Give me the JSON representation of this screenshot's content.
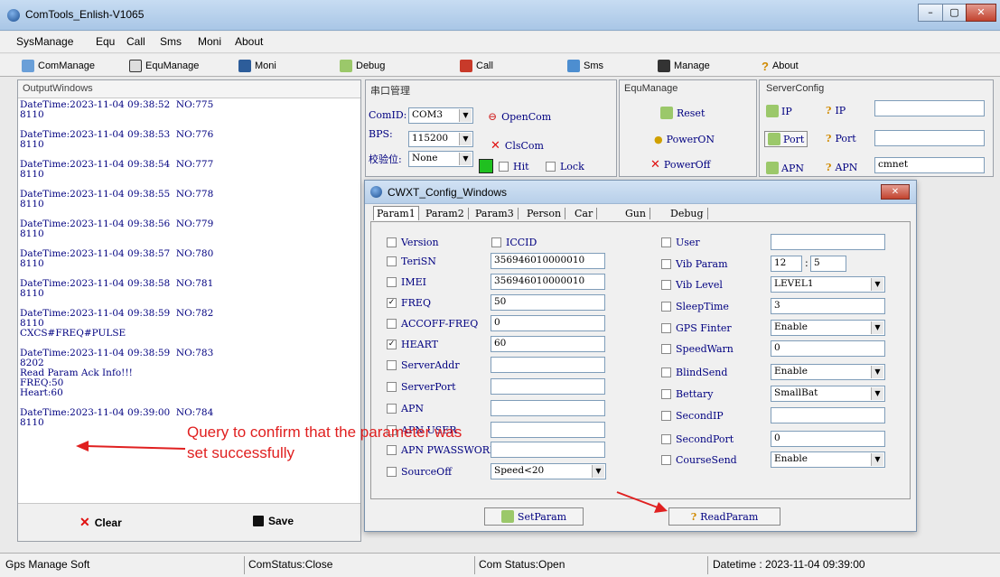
{
  "window": {
    "title": "ComTools_Enlish-V1065",
    "min": "–",
    "max": "▢",
    "close": "✕"
  },
  "menu": [
    "SysManage",
    "Equ",
    "Call",
    "Sms",
    "Moni",
    "About"
  ],
  "toolbar": [
    "ComManage",
    "EquManage",
    "Moni",
    "Debug",
    "Call",
    "Sms",
    "Manage",
    "About"
  ],
  "output": {
    "title": "OutputWindows",
    "log": "DateTime:2023-11-04 09:38:52  NO:775\n8110\n\nDateTime:2023-11-04 09:38:53  NO:776\n8110\n\nDateTime:2023-11-04 09:38:54  NO:777\n8110\n\nDateTime:2023-11-04 09:38:55  NO:778\n8110\n\nDateTime:2023-11-04 09:38:56  NO:779\n8110\n\nDateTime:2023-11-04 09:38:57  NO:780\n8110\n\nDateTime:2023-11-04 09:38:58  NO:781\n8110\n\nDateTime:2023-11-04 09:38:59  NO:782\n8110\nCXCS#FREQ#PULSE\n\nDateTime:2023-11-04 09:38:59  NO:783\n8202\nRead Param Ack Info!!!\nFREQ:50\nHeart:60\n\nDateTime:2023-11-04 09:39:00  NO:784\n8110",
    "clear": "Clear",
    "save": "Save"
  },
  "serial": {
    "title": "串口管理",
    "comid_label": "ComID:",
    "comid": "COM3",
    "bps_label": "BPS:",
    "bps": "115200",
    "check_label": "校验位:",
    "check": "None",
    "open": "OpenCom",
    "close": "ClsCom",
    "hit": "Hit",
    "lock": "Lock"
  },
  "equ": {
    "title": "EquManage",
    "reset": "Reset",
    "poweron": "PowerON",
    "poweroff": "PowerOff"
  },
  "server": {
    "title": "ServerConfig",
    "ip_btn": "IP",
    "ip_q": "IP",
    "port_btn": "Port",
    "port_q": "Port",
    "apn_btn": "APN",
    "apn_q": "APN",
    "apn_value": "cmnet"
  },
  "dialog": {
    "title": "CWXT_Config_Windows",
    "tabs": [
      "Param1",
      "Param2",
      "Param3",
      "Person",
      "Car",
      "Gun",
      "Debug"
    ],
    "left": [
      {
        "label": "Version",
        "checked": false
      },
      {
        "label": "TeriSN",
        "checked": false,
        "value": "356946010000010"
      },
      {
        "label": "IMEI",
        "checked": false,
        "value": "356946010000010"
      },
      {
        "label": "FREQ",
        "checked": true,
        "value": "50"
      },
      {
        "label": "ACCOFF-FREQ",
        "checked": false,
        "value": "0"
      },
      {
        "label": "HEART",
        "checked": true,
        "value": "60"
      },
      {
        "label": "ServerAddr",
        "checked": false,
        "value": ""
      },
      {
        "label": "ServerPort",
        "checked": false,
        "value": ""
      },
      {
        "label": "APN",
        "checked": false,
        "value": ""
      },
      {
        "label": "APN USER",
        "checked": false,
        "value": ""
      },
      {
        "label": "APN PWASSWORD",
        "checked": false,
        "value": ""
      },
      {
        "label": "SourceOff",
        "checked": false,
        "value": "Speed<20"
      }
    ],
    "iccid": "ICCID",
    "right": [
      {
        "label": "User",
        "value": ""
      },
      {
        "label": "Vib Param",
        "value": "12",
        "value2": "5"
      },
      {
        "label": "Vib Level",
        "value": "LEVEL1"
      },
      {
        "label": "SleepTime",
        "value": "3"
      },
      {
        "label": "GPS Finter",
        "value": "Enable"
      },
      {
        "label": "SpeedWarn",
        "value": "0"
      },
      {
        "label": "BlindSend",
        "value": "Enable"
      },
      {
        "label": "Bettary",
        "value": "SmallBat"
      },
      {
        "label": "SecondIP",
        "value": ""
      },
      {
        "label": "SecondPort",
        "value": "0"
      },
      {
        "label": "CourseSend",
        "value": "Enable"
      }
    ],
    "set": "SetParam",
    "read": "ReadParam"
  },
  "annotation": "Query to confirm that the parameter was set successfully",
  "status": {
    "app": "Gps Manage Soft",
    "com1": "ComStatus:Close",
    "com2": "Com Status:Open",
    "datetime": "Datetime : 2023-11-04 09:39:00"
  }
}
